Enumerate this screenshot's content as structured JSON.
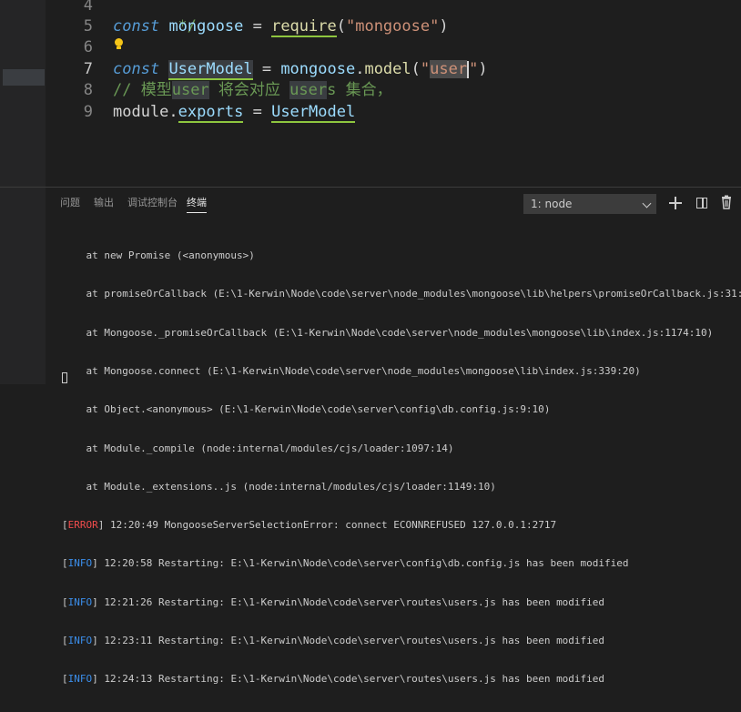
{
  "editor": {
    "lines": [
      {
        "num": "4",
        "text": "*/"
      },
      {
        "num": "5",
        "kw": "const",
        "var": "mongoose",
        "eq": "=",
        "fn": "require",
        "open": "(",
        "str": "\"mongoose\"",
        "close": ")"
      },
      {
        "num": "6"
      },
      {
        "num": "7",
        "kw": "const",
        "var": "UserModel",
        "eq": "=",
        "obj": "mongoose",
        "dot": ".",
        "fn": "model",
        "open": "(",
        "str_q1": "\"",
        "str_u": "us",
        "str_e": "e",
        "str_r": "r",
        "str_q2": "\"",
        "close": ")"
      },
      {
        "num": "8",
        "c1": "// 模型",
        "c2": "user",
        "c3": " 将会对应 ",
        "c4": "user",
        "c5": "s 集合，"
      },
      {
        "num": "9",
        "obj": "module",
        "dot": ".",
        "prop": "exports",
        "eq": "=",
        "val": "UserModel"
      }
    ]
  },
  "panel": {
    "tabs": [
      "问题",
      "输出",
      "调试控制台",
      "终端"
    ],
    "active_tab": "终端",
    "terminal_select": "1: node"
  },
  "terminal": {
    "stack_lines": [
      "    at new Promise (<anonymous>)",
      "    at promiseOrCallback (E:\\1-Kerwin\\Node\\code\\server\\node_modules\\mongoose\\lib\\helpers\\promiseOrCallback.js:31:10)",
      "    at Mongoose._promiseOrCallback (E:\\1-Kerwin\\Node\\code\\server\\node_modules\\mongoose\\lib\\index.js:1174:10)",
      "    at Mongoose.connect (E:\\1-Kerwin\\Node\\code\\server\\node_modules\\mongoose\\lib\\index.js:339:20)",
      "    at Object.<anonymous> (E:\\1-Kerwin\\Node\\code\\server\\config\\db.config.js:9:10)",
      "    at Module._compile (node:internal/modules/cjs/loader:1097:14)",
      "    at Module._extensions..js (node:internal/modules/cjs/loader:1149:10)"
    ],
    "error_line": {
      "tag": "ERROR",
      "text": " 12:20:49 MongooseServerSelectionError: connect ECONNREFUSED 127.0.0.1:2717"
    },
    "info_lines": [
      {
        "tag": "INFO",
        "text": " 12:20:58 Restarting: E:\\1-Kerwin\\Node\\code\\server\\config\\db.config.js has been modified"
      },
      {
        "tag": "INFO",
        "text": " 12:21:26 Restarting: E:\\1-Kerwin\\Node\\code\\server\\routes\\users.js has been modified"
      },
      {
        "tag": "INFO",
        "text": " 12:23:11 Restarting: E:\\1-Kerwin\\Node\\code\\server\\routes\\users.js has been modified"
      },
      {
        "tag": "INFO",
        "text": " 12:24:13 Restarting: E:\\1-Kerwin\\Node\\code\\server\\routes\\users.js has been modified"
      }
    ]
  },
  "colors": {
    "background": "#1e1e1e",
    "keyword": "#569cd6",
    "string": "#ce9178",
    "function": "#dcdcaa",
    "comment": "#6a9955",
    "error": "#f14c4c",
    "info": "#3b8eea"
  },
  "icons": {
    "lightbulb": "lightbulb-icon",
    "add": "add-terminal-icon",
    "split": "split-terminal-icon",
    "trash": "trash-icon",
    "chevron": "chevron-down-icon"
  }
}
